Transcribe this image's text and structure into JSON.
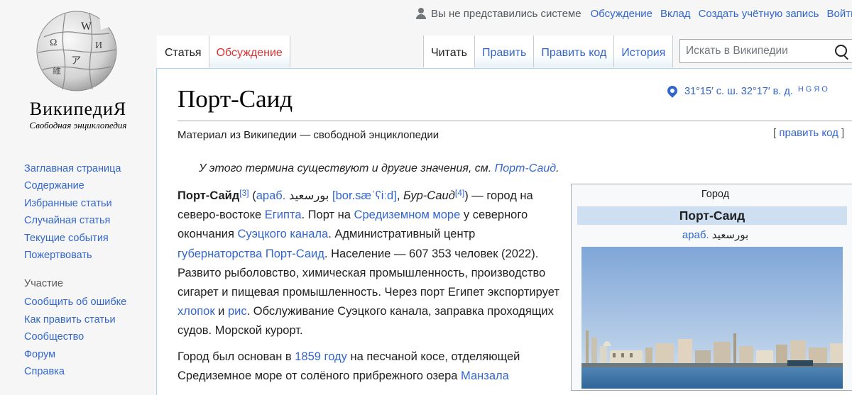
{
  "personal_tools": {
    "anon": "Вы не представились системе",
    "talk": "Обсуждение",
    "contributions": "Вклад",
    "create_account": "Создать учётную запись",
    "login": "Войти"
  },
  "logo": {
    "wordmark": "ВикипедиЯ",
    "tagline": "Свободная энциклопедия"
  },
  "sidebar": {
    "nav": [
      "Заглавная страница",
      "Содержание",
      "Избранные статьи",
      "Случайная статья",
      "Текущие события",
      "Пожертвовать"
    ],
    "participation_heading": "Участие",
    "participation": [
      "Сообщить об ошибке",
      "Как править статьи",
      "Сообщество",
      "Форум",
      "Справка"
    ]
  },
  "tabs": {
    "left": [
      "Статья",
      "Обсуждение"
    ],
    "right": [
      "Читать",
      "Править",
      "Править код",
      "История"
    ]
  },
  "search": {
    "placeholder": "Искать в Википедии"
  },
  "article": {
    "title": "Порт-Саид",
    "coords": "31°15′ с. ш. 32°17′ в. д.",
    "coords_maps": "HGЯO",
    "site_sub": "Материал из Википедии — свободной энциклопедии",
    "edit_link": "править код",
    "hatnote_text": "У этого термина существуют и другие значения, см. ",
    "hatnote_link": "Порт-Саид",
    "p1": {
      "name": "Порт-Сайд",
      "ref3": "[3]",
      "lang": "араб.",
      "arabic": "بورسعيد",
      "ipa": "[bor.sæˈʕiːd]",
      "alt": "Бур-Саид",
      "ref4": "[4]",
      "t1": "— город на северо-востоке ",
      "l_egypt": "Египта",
      "t2": ". Порт на ",
      "l_med": "Средиземном море",
      "t3": " у северного окончания ",
      "l_suez": "Суэцкого канала",
      "t4": ". Административный центр ",
      "l_gov": "губернаторства Порт-Саид",
      "t5": ". Население — 607 353 человек (2022). Развито рыболовство, химическая промышленность, производство сигарет и пищевая промышленность. Через порт Египет экспортирует ",
      "l_cotton": "хлопок",
      "t6": " и ",
      "l_rice": "рис",
      "t7": ". Обслуживание Суэцкого канала, заправка проходящих судов. Морской курорт."
    },
    "p2": {
      "t1": "Город был основан в ",
      "l_1859": "1859 году",
      "t2": " на песчаной косе, отделяющей Средиземное море от солёного прибрежного озера ",
      "l_manzala": "Манзала"
    }
  },
  "infobox": {
    "kind": "Город",
    "title": "Порт-Саид",
    "lang": "араб.",
    "arabic": "بورسعيد"
  }
}
